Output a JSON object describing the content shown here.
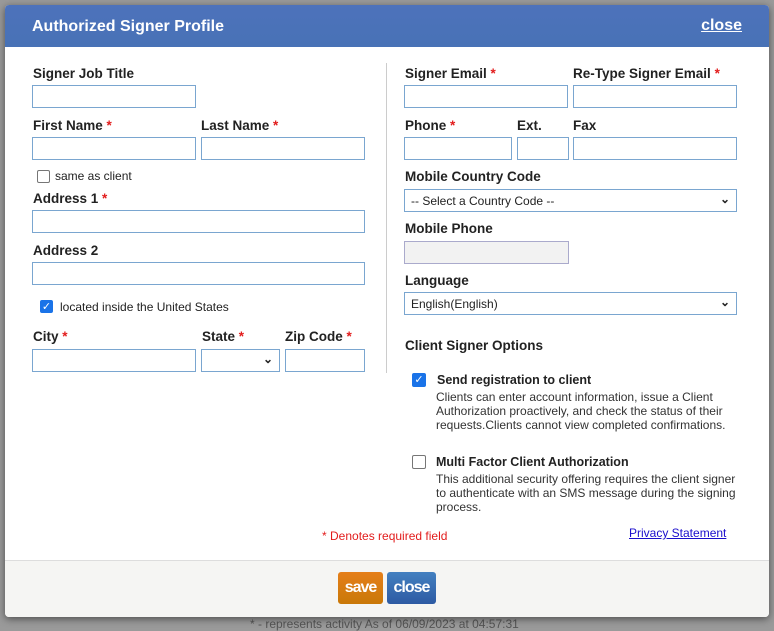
{
  "header": {
    "title": "Authorized Signer Profile",
    "close": "close"
  },
  "left": {
    "job_title": "Signer Job Title",
    "first_name": "First Name",
    "last_name": "Last Name",
    "same_as_client": "same as client",
    "address1": "Address 1",
    "address2": "Address 2",
    "inside_us": "located inside the United States",
    "city": "City",
    "state": "State",
    "zip": "Zip Code"
  },
  "right": {
    "email": "Signer Email",
    "retype_email": "Re-Type Signer Email",
    "phone": "Phone",
    "ext": "Ext.",
    "fax": "Fax",
    "mobile_country_code": "Mobile Country Code",
    "country_code_value": "-- Select a Country Code --",
    "mobile_phone": "Mobile Phone",
    "language": "Language",
    "language_value": "English(English)",
    "options_title": "Client Signer Options",
    "opt1_label": "Send registration to client",
    "opt1_desc": "Clients can enter account information, issue a Client Authorization proactively, and check the status of their requests.Clients cannot view completed confirmations.",
    "opt1_checked": true,
    "opt2_label": "Multi Factor Client Authorization",
    "opt2_desc": "This additional security offering requires the client signer to authenticate with an SMS message during the signing process.",
    "opt2_checked": false
  },
  "required_note": "* Denotes required field",
  "privacy": "Privacy Statement",
  "req_mark": "*",
  "footer": {
    "save": "save",
    "close": "close"
  },
  "background_text": "* - represents activity As of 06/09/2023 at 04:57:31",
  "colors": {
    "header": "#4872b6",
    "save": "#dd7b17",
    "close_btn": "#3a6db0",
    "required": "#e21c1c"
  }
}
